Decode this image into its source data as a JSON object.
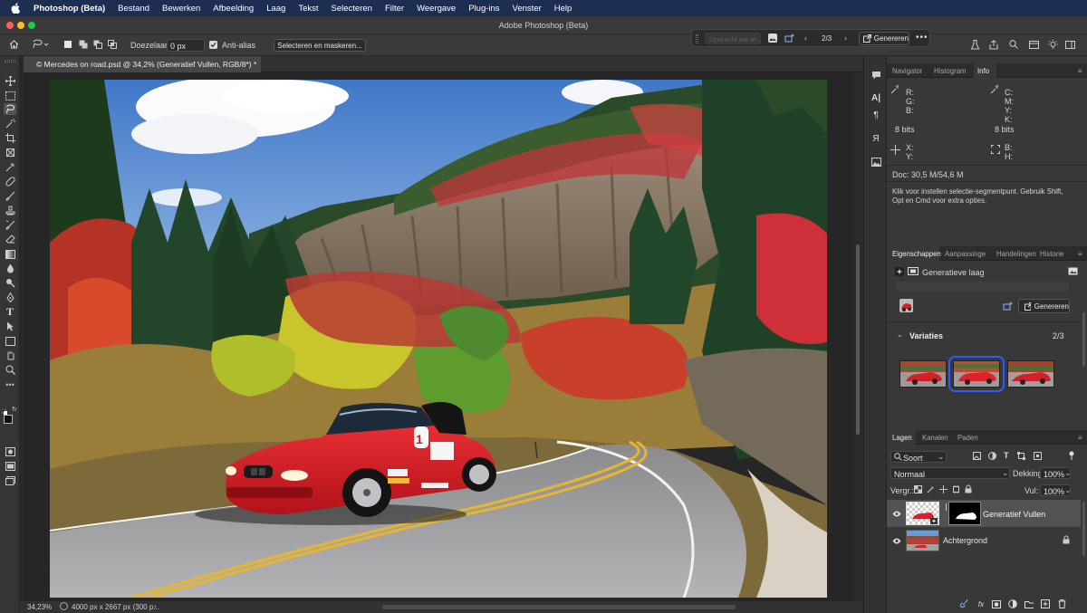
{
  "menubar": {
    "items": [
      "Photoshop (Beta)",
      "Bestand",
      "Bewerken",
      "Afbeelding",
      "Laag",
      "Tekst",
      "Selecteren",
      "Filter",
      "Weergave",
      "Plug-ins",
      "Venster",
      "Help"
    ]
  },
  "window": {
    "title": "Adobe Photoshop (Beta)"
  },
  "options_bar": {
    "feather_label": "Doezelaar:",
    "feather_value": "0 px",
    "antialias_label": "Anti-alias",
    "select_mask_label": "Selecteren en maskeren..."
  },
  "contextual_bar": {
    "prompt_placeholder": "Opdracht toe te...",
    "variation_counter": "2/3",
    "generate_label": "Genereren"
  },
  "document": {
    "tab_title": "© Mercedes on road.psd @ 34,2% (Generatief Vullen, RGB/8*) *",
    "zoom_status": "34,23%",
    "size_status": "4000 px x 2667 px (300 p..."
  },
  "info_panel": {
    "tabs": [
      "Navigator",
      "Histogram",
      "Info"
    ],
    "rgb_labels": [
      "R:",
      "G:",
      "B:"
    ],
    "cmyk_labels": [
      "C:",
      "M:",
      "Y:",
      "K:"
    ],
    "bits_left": "8 bits",
    "bits_right": "8 bits",
    "xy_labels": [
      "X:",
      "Y:"
    ],
    "bh_labels": [
      "B:",
      "H:"
    ],
    "doc_size": "Doc: 30,5 M/54,6 M",
    "hint": [
      "Klik voor instellen selectie-segmentpunt.  Gebruik Shift,",
      "Opt en Cmd voor extra opties."
    ]
  },
  "properties_panel": {
    "tabs": [
      "Eigenschappen",
      "Aanpassinge",
      "Handelingen",
      "Historie"
    ],
    "layer_type": "Generatieve laag",
    "generate_label": "Genereren",
    "variations_label": "Variaties",
    "variations_count": "2/3"
  },
  "layers_panel": {
    "tabs": [
      "Lagen",
      "Kanalen",
      "Paden"
    ],
    "filter_kind": "Soort",
    "blend_mode": "Normaal",
    "opacity_label": "Dekking:",
    "opacity_value": "100%",
    "lock_label": "Vergr.:",
    "fill_label": "Vul:",
    "fill_value": "100%",
    "layers": [
      {
        "name": "Generatief Vullen"
      },
      {
        "name": "Achtergrond"
      }
    ]
  },
  "colors": {
    "menubar_bg": "#1d2e52",
    "panel_bg": "#383838",
    "selection_blue": "#2d5cff",
    "car_red": "#e0202a"
  }
}
